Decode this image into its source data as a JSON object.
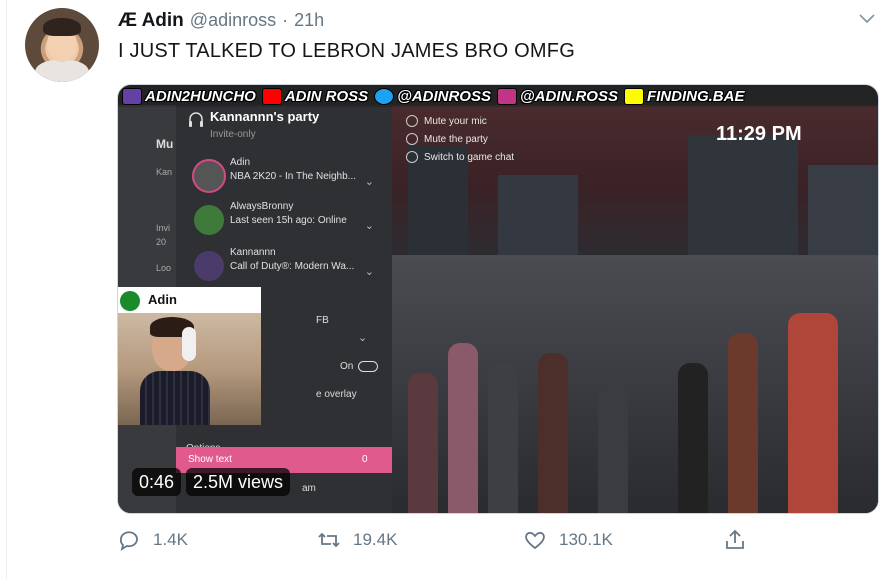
{
  "tweet": {
    "author_name": "Æ Adin",
    "handle": "@adinross",
    "separator": "·",
    "time": "21h",
    "text": "I JUST TALKED TO LEBRON JAMES BRO OMFG"
  },
  "video": {
    "banner": {
      "items": [
        {
          "label": "ADIN2HUNCHO",
          "icon": "twitch-icon",
          "color": "#6441a5"
        },
        {
          "label": "ADIN ROSS",
          "icon": "youtube-icon",
          "color": "#ff0000"
        },
        {
          "label": "@ADINROSS",
          "icon": "twitter-icon",
          "color": "#1da1f2"
        },
        {
          "label": "@ADIN.ROSS",
          "icon": "instagram-icon",
          "color": "#c13584"
        },
        {
          "label": "FINDING.BAE",
          "icon": "snapchat-icon",
          "color": "#fffc00"
        }
      ]
    },
    "clock": "11:29 PM",
    "party": {
      "title": "Kannannn's party",
      "subtitle": "Invite-only",
      "members": [
        {
          "name": "Adin",
          "status": "NBA 2K20 - In The Neighb..."
        },
        {
          "name": "AlwaysBronny",
          "status": "Last seen 15h ago: Online"
        },
        {
          "name": "Kannannn",
          "status": "Call of Duty®: Modern Wa..."
        }
      ],
      "fb_fragment": "FB",
      "toggle_label": "On",
      "overlay_fragment": "e overlay",
      "options_label": "Options",
      "show_text_label": "Show text",
      "show_text_value": "0"
    },
    "left_panel_fragments": [
      "Mu",
      "Kan",
      "Invi",
      "20",
      "Loo"
    ],
    "controls": [
      "Mute your mic",
      "Mute the party",
      "Switch to game chat"
    ],
    "webcam": {
      "name": "Adin"
    },
    "duration": "0:46",
    "views": "2.5M views",
    "bottom_fragment": "am"
  },
  "actions": {
    "reply_count": "1.4K",
    "retweet_count": "19.4K",
    "like_count": "130.1K"
  }
}
